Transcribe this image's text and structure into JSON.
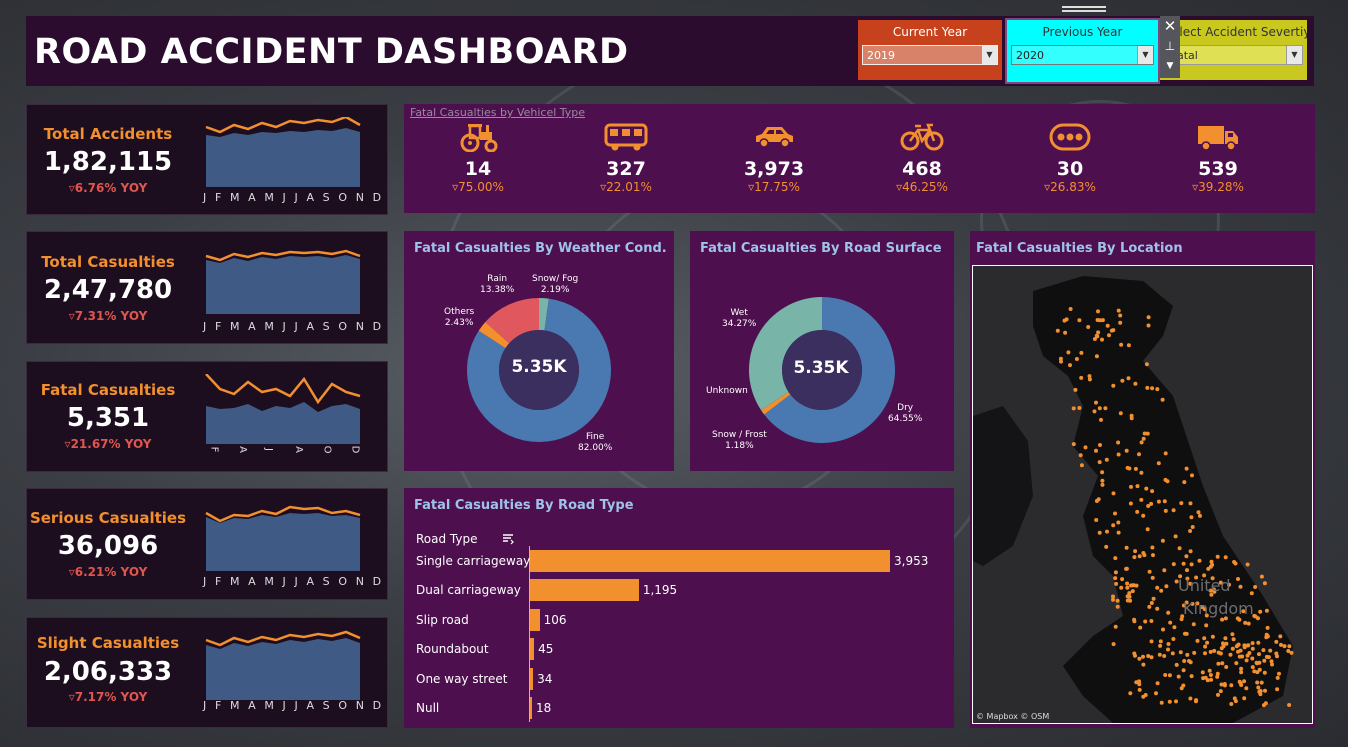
{
  "header": {
    "title": "ROAD ACCIDENT DASHBOARD"
  },
  "filters": {
    "current_year": {
      "label": "Current Year",
      "value": "2019"
    },
    "previous_year": {
      "label": "Previous Year",
      "value": "2020"
    },
    "severity": {
      "label": "elect Accident Severtiy",
      "value": "atal"
    }
  },
  "months": "J F M A M J J A S O N D",
  "months_short": [
    "F",
    "A",
    "J",
    "A",
    "O",
    "D"
  ],
  "kpis": [
    {
      "label": "Total Accidents",
      "value": "1,82,115",
      "yoy": "▿6.76% YOY",
      "spark_top": [
        60,
        55,
        62,
        58,
        64,
        60,
        66,
        64,
        67,
        65,
        70,
        62
      ],
      "spark_area": [
        52,
        50,
        54,
        52,
        55,
        54,
        56,
        55,
        57,
        56,
        59,
        55
      ]
    },
    {
      "label": "Total Casualties",
      "value": "2,47,780",
      "yoy": "▿7.31% YOY",
      "spark_top": [
        58,
        54,
        60,
        57,
        61,
        59,
        62,
        61,
        62,
        60,
        63,
        58
      ],
      "spark_area": [
        54,
        51,
        56,
        53,
        57,
        55,
        58,
        57,
        58,
        56,
        59,
        55
      ]
    },
    {
      "label": "Fatal Casualties",
      "value": "5,351",
      "yoy": "▿21.67% YOY",
      "spark_top": [
        70,
        55,
        50,
        62,
        52,
        55,
        48,
        65,
        42,
        60,
        52,
        48
      ],
      "spark_area": [
        38,
        35,
        36,
        40,
        33,
        38,
        36,
        42,
        32,
        38,
        40,
        35
      ]
    },
    {
      "label": "Serious Casualties",
      "value": "36,096",
      "yoy": "▿6.21% YOY",
      "spark_top": [
        58,
        50,
        56,
        55,
        60,
        57,
        64,
        62,
        63,
        58,
        60,
        56
      ],
      "spark_area": [
        54,
        48,
        53,
        52,
        56,
        54,
        58,
        57,
        58,
        55,
        56,
        53
      ]
    },
    {
      "label": "Slight Casualties",
      "value": "2,06,333",
      "yoy": "▿7.17% YOY",
      "spark_top": [
        60,
        55,
        62,
        58,
        63,
        60,
        65,
        63,
        66,
        64,
        68,
        62
      ],
      "spark_area": [
        55,
        51,
        57,
        54,
        58,
        56,
        60,
        58,
        61,
        59,
        62,
        57
      ]
    }
  ],
  "vehicle_types": {
    "title": "Fatal Casualties by Vehicel Type",
    "items": [
      {
        "icon": "tractor-icon",
        "value": "14",
        "pct": "▿75.00%"
      },
      {
        "icon": "bus-icon",
        "value": "327",
        "pct": "▿22.01%"
      },
      {
        "icon": "car-icon",
        "value": "3,973",
        "pct": "▿17.75%"
      },
      {
        "icon": "bicycle-icon",
        "value": "468",
        "pct": "▿46.25%"
      },
      {
        "icon": "other-vehicle-icon",
        "value": "30",
        "pct": "▿26.83%"
      },
      {
        "icon": "truck-icon",
        "value": "539",
        "pct": "▿39.28%"
      }
    ]
  },
  "weather": {
    "title": "Fatal Casualties By Weather Cond.",
    "center": "5.35K",
    "labels": {
      "rain": "Rain",
      "rain_pct": "13.38%",
      "snow": "Snow/ Fog",
      "snow_pct": "2.19%",
      "others": "Others",
      "others_pct": "2.43%",
      "fine": "Fine",
      "fine_pct": "82.00%"
    }
  },
  "surface": {
    "title": "Fatal Casualties By Road Surface",
    "center": "5.35K",
    "labels": {
      "wet": "Wet",
      "wet_pct": "34.27%",
      "unknown": "Unknown",
      "snow": "Snow / Frost",
      "snow_pct": "1.18%",
      "dry": "Dry",
      "dry_pct": "64.55%"
    }
  },
  "location": {
    "title": "Fatal Casualties By Location",
    "country": "United\nKingdom",
    "credit": "© Mapbox © OSM"
  },
  "road_type": {
    "title": "Fatal Casualties By Road Type",
    "header": "Road Type"
  },
  "colors": {
    "accent": "#f28f2e",
    "panel_purple": "#4d0f4e",
    "panel_dark": "#1c0e1f",
    "donut_blue": "#4a78b0",
    "donut_red": "#e0585e",
    "donut_teal": "#78b5a8",
    "area_blue": "#3f5a85"
  },
  "chart_data": [
    {
      "type": "pie",
      "title": "Fatal Casualties By Weather Cond.",
      "categories": [
        "Fine",
        "Others",
        "Rain",
        "Snow/ Fog"
      ],
      "values": [
        82.0,
        2.43,
        13.38,
        2.19
      ]
    },
    {
      "type": "pie",
      "title": "Fatal Casualties By Road Surface",
      "categories": [
        "Dry",
        "Snow / Frost",
        "Wet"
      ],
      "values": [
        64.55,
        1.18,
        34.27
      ]
    },
    {
      "type": "bar",
      "title": "Fatal Casualties By Road Type",
      "xlabel": "",
      "ylabel": "Road Type",
      "categories": [
        "Single carriageway",
        "Dual carriageway",
        "Slip road",
        "Roundabout",
        "One way street",
        "Null"
      ],
      "values": [
        3953,
        1195,
        106,
        45,
        34,
        18
      ],
      "value_labels": [
        "3,953",
        "1,195",
        "106",
        "45",
        "34",
        "18"
      ]
    }
  ]
}
